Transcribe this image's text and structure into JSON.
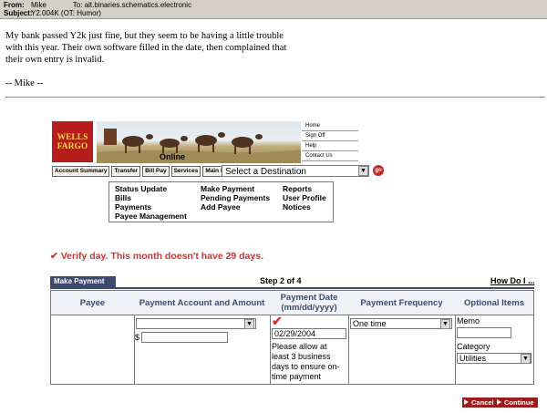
{
  "email": {
    "from_label": "From:",
    "from": "Mike",
    "to_label": "To:",
    "to": "alt.binaries.schematics.electronic",
    "subject_label": "Subject:",
    "subject": "Y2.004K (OT: Humor)",
    "body": [
      "My bank passed Y2k just fine, but they seem to be having a little trouble",
      "with this year. Their own software filled in the date, then complained that",
      "their own entry is invalid.",
      "",
      "-- Mike --"
    ]
  },
  "brand": {
    "logo_line1": "WELLS",
    "logo_line2": "FARGO",
    "online": "Online"
  },
  "sidelinks": [
    "Home",
    "Sign Off",
    "Help",
    "Contact Us"
  ],
  "tabs": [
    "Account Summary",
    "Transfer",
    "Bill Pay",
    "Services",
    "Main Menu"
  ],
  "destination": {
    "value": "Select a Destination",
    "go": "go"
  },
  "menu": {
    "col1": [
      "Status Update",
      "Bills",
      "Payments",
      "Payee Management"
    ],
    "col2": [
      "Make Payment",
      "Pending Payments",
      "Add Payee"
    ],
    "col3": [
      "Reports",
      "User Profile",
      "Notices"
    ]
  },
  "error": "Verify day. This month doesn't have 29 days.",
  "form": {
    "tab": "Make Payment",
    "step": "Step 2 of 4",
    "help": "How Do I ...",
    "headers": [
      "Payee",
      "Payment Account and Amount",
      "Payment Date (mm/dd/yyyy)",
      "Payment Frequency",
      "Optional Items"
    ],
    "currency": "$",
    "date_value": "02/29/2004",
    "date_note": "Please allow at least 3 business days to ensure on-time payment",
    "frequency": "One time",
    "memo_label": "Memo",
    "category_label": "Category",
    "category_value": "Utilities"
  },
  "buttons": {
    "cancel": "Cancel",
    "continue": "Continue"
  },
  "colors": {
    "error_red": "#d32f2f",
    "navy": "#3d4a70",
    "brand_red": "#b71c1c"
  }
}
